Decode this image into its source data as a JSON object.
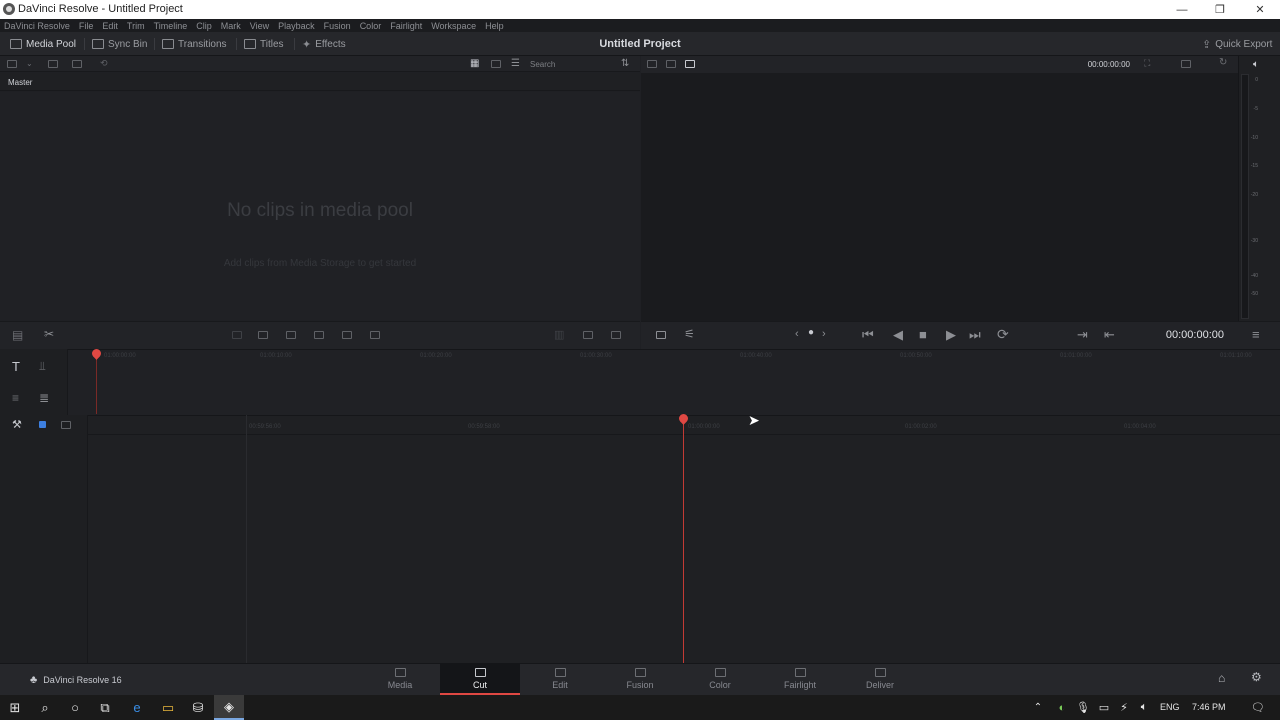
{
  "window": {
    "title": "DaVinci Resolve - Untitled Project",
    "minimize_glyph": "—",
    "maximize_glyph": "❐",
    "close_glyph": "✕"
  },
  "menu": [
    "DaVinci Resolve",
    "File",
    "Edit",
    "Trim",
    "Timeline",
    "Clip",
    "Mark",
    "View",
    "Playback",
    "Fusion",
    "Color",
    "Fairlight",
    "Workspace",
    "Help"
  ],
  "toolbar": {
    "media_pool": "Media Pool",
    "sync_bin": "Sync Bin",
    "transitions": "Transitions",
    "titles": "Titles",
    "effects": "Effects",
    "project_title": "Untitled Project",
    "quick_export": "Quick Export"
  },
  "media_pool": {
    "bin_name": "Master",
    "search_placeholder": "Search",
    "empty_title": "No clips in media pool",
    "empty_subtitle": "Add clips from Media Storage to get started"
  },
  "viewer": {
    "timecode_top": "00:00:00:00",
    "transport_timecode": "00:00:00:00"
  },
  "audio_meter": {
    "labels": [
      "0",
      "-5",
      "-10",
      "-15",
      "-20",
      "-30",
      "-40",
      "-50"
    ]
  },
  "timeline_upper": {
    "ticks": [
      "01:00:00:00",
      "01:00:10:00",
      "01:00:20:00",
      "01:00:30:00",
      "01:00:40:00",
      "01:00:50:00",
      "01:01:00:00",
      "01:01:10:00"
    ]
  },
  "timeline_lower": {
    "ticks": [
      "00:59:56:00",
      "00:59:58:00",
      "01:00:00:00",
      "01:00:02:00",
      "01:00:04:00"
    ]
  },
  "pages": {
    "brand": "DaVinci Resolve 16",
    "tabs": [
      "Media",
      "Cut",
      "Edit",
      "Fusion",
      "Color",
      "Fairlight",
      "Deliver"
    ],
    "active": "Cut"
  },
  "taskbar": {
    "language": "ENG",
    "time": "7:46 PM"
  },
  "colors": {
    "accent": "#e04843",
    "background": "#1f2024"
  }
}
